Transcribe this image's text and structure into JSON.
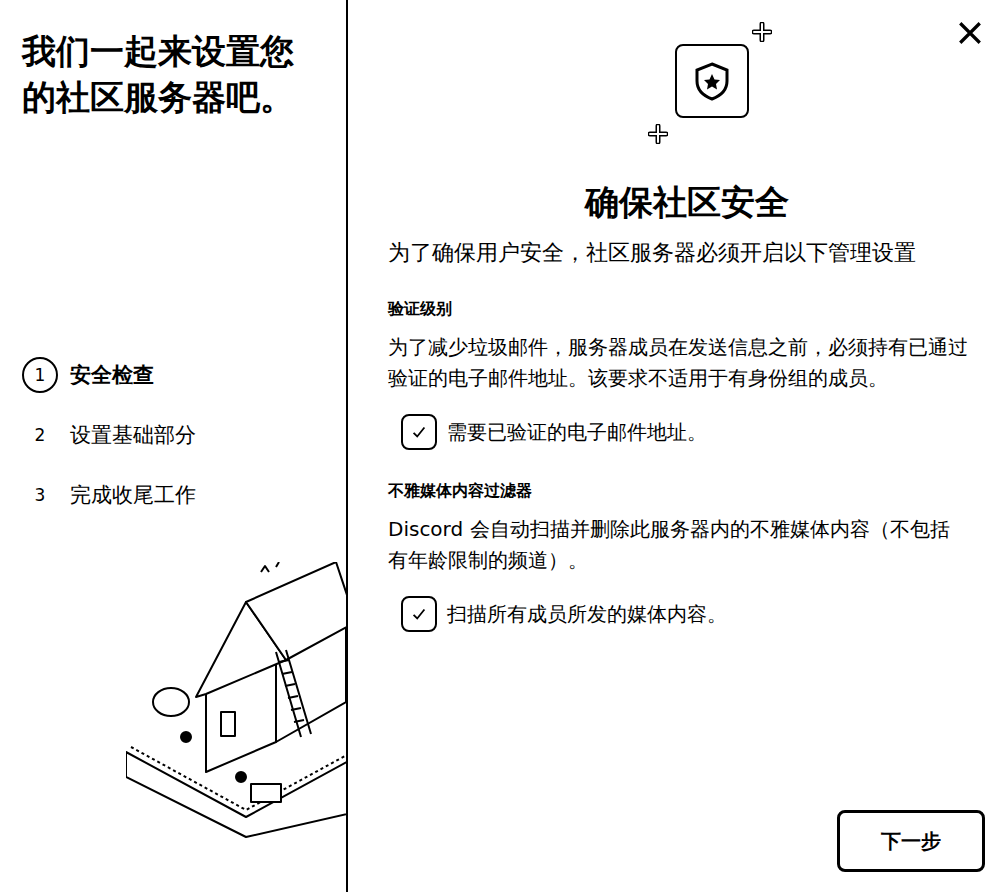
{
  "sidebar": {
    "title": "我们一起来设置您的社区服务器吧。",
    "steps": [
      {
        "number": "1",
        "label": "安全检查",
        "selected": true
      },
      {
        "number": "2",
        "label": "设置基础部分",
        "selected": false
      },
      {
        "number": "3",
        "label": "完成收尾工作",
        "selected": false
      }
    ]
  },
  "header": {
    "title": "确保社区安全",
    "subtitle": "为了确保用户安全，社区服务器必须开启以下管理设置"
  },
  "sections": [
    {
      "heading": "验证级别",
      "description": "为了减少垃圾邮件，服务器成员在发送信息之前，必须持有已通过验证的电子邮件地址。该要求不适用于有身份组的成员。",
      "option": {
        "label": "需要已验证的电子邮件地址。",
        "checked": true
      }
    },
    {
      "heading": "不雅媒体内容过滤器",
      "description": "Discord 会自动扫描并删除此服务器内的不雅媒体内容（不包括有年龄限制的频道）。",
      "option": {
        "label": "扫描所有成员所发的媒体内容。",
        "checked": true
      }
    }
  ],
  "buttons": [
    "下一步"
  ]
}
